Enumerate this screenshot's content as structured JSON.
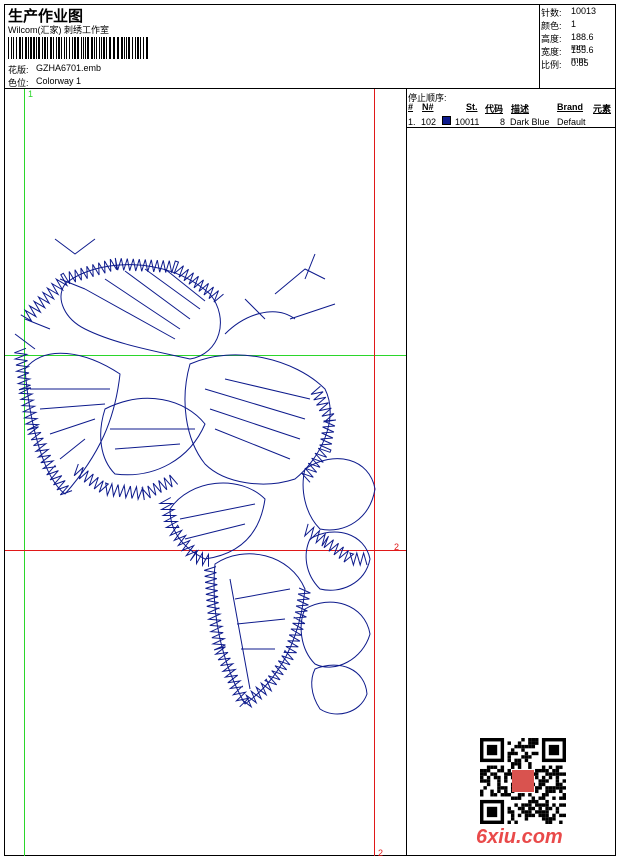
{
  "header": {
    "title": "生产作业图",
    "company": "Wilcom(汇家) 刺绣工作室",
    "design_label": "花版:",
    "design_value": "GZHA6701.emb",
    "colorway_label": "色位:",
    "colorway_value": "Colorway 1"
  },
  "stats": [
    {
      "label": "针数:",
      "value": "10013"
    },
    {
      "label": "颜色:",
      "value": "1"
    },
    {
      "label": "高度:",
      "value": "188.6 mm"
    },
    {
      "label": "宽度:",
      "value": "155.6 mm"
    },
    {
      "label": "比例:",
      "value": "0.85"
    }
  ],
  "stop_sequence": {
    "title": "停止顺序:",
    "headers": {
      "hash": "#",
      "n": "N#",
      "st": "St.",
      "code": "代码",
      "desc": "描述",
      "brand": "Brand",
      "element": "元素"
    },
    "rows": [
      {
        "index": "1.",
        "n": "102",
        "code": "10011",
        "st": "8",
        "desc": "Dark Blue",
        "brand": "Default",
        "swatch": "#0d1a8c"
      }
    ]
  },
  "guides": {
    "green_label": "1",
    "red_label_right": "2",
    "red_label_bottom": "2",
    "green_color": "#2bd62b",
    "red_color": "#e01818"
  },
  "embroidery_color": "#0d1a8c",
  "watermark": "6xiu.com"
}
